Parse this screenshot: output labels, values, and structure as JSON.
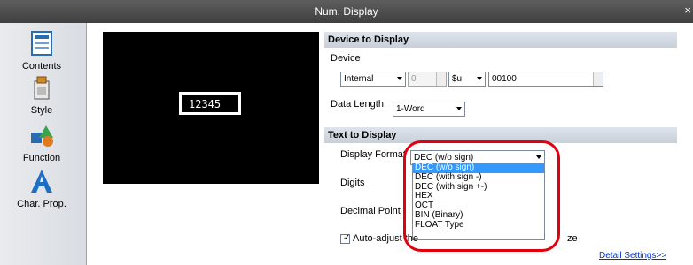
{
  "window": {
    "title": "Num. Display",
    "close_glyph": "×"
  },
  "sidebar": {
    "items": [
      {
        "label": "Contents",
        "icon": "contents-icon"
      },
      {
        "label": "Style",
        "icon": "style-icon"
      },
      {
        "label": "Function",
        "icon": "function-icon"
      },
      {
        "label": "Char. Prop.",
        "icon": "char-prop-icon"
      }
    ]
  },
  "preview": {
    "value": "12345"
  },
  "device_section": {
    "header": "Device to Display",
    "device_label": "Device",
    "device_type": "Internal",
    "device_index": "0",
    "device_prefix": "$u",
    "device_address": "00100",
    "data_length_label": "Data Length",
    "data_length": "1-Word"
  },
  "text_section": {
    "header": "Text to Display",
    "display_format_label": "Display Format",
    "display_format": "DEC (w/o sign)",
    "options": [
      "DEC (w/o sign)",
      "DEC (with sign -)",
      "DEC (with sign +-)",
      "HEX",
      "OCT",
      "BIN (Binary)",
      "FLOAT Type"
    ],
    "digits_label": "Digits",
    "decimal_point_label": "Decimal Point",
    "auto_adjust_label_start": "Auto-adjust the",
    "auto_adjust_label_end": "ze",
    "auto_adjust_checked": true,
    "detail_link": "Detail Settings>>"
  },
  "colors": {
    "highlight": "#e00010",
    "selection": "#3399ff"
  }
}
